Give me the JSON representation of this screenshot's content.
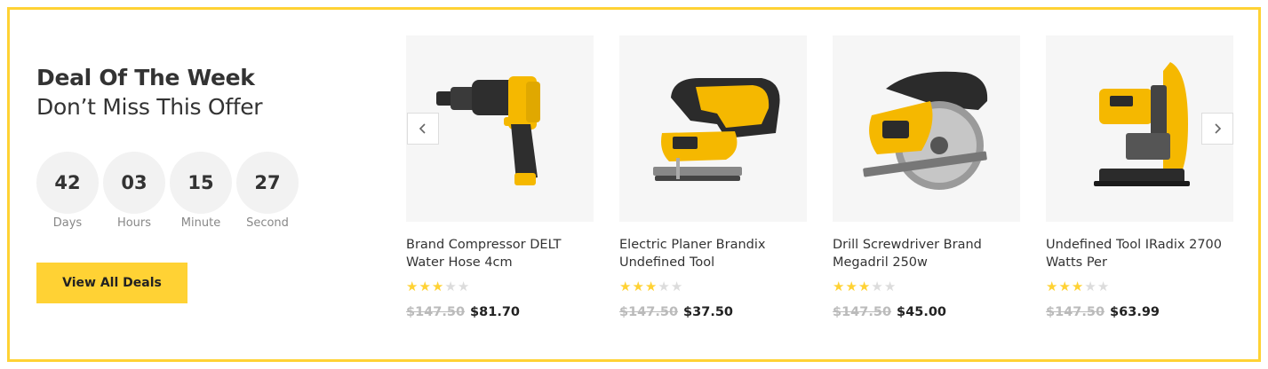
{
  "deal": {
    "title": "Deal Of The Week",
    "subtitle": "Don’t Miss This Offer",
    "view_all_label": "View All Deals",
    "accent_color": "#ffd234"
  },
  "countdown": [
    {
      "value": "42",
      "label": "Days"
    },
    {
      "value": "03",
      "label": "Hours"
    },
    {
      "value": "15",
      "label": "Minute"
    },
    {
      "value": "27",
      "label": "Second"
    }
  ],
  "carousel": {
    "prev_icon": "chevron-left-icon",
    "next_icon": "chevron-right-icon"
  },
  "products": [
    {
      "name": "Brand Compressor DELT Water Hose 4cm",
      "rating": 3,
      "rating_max": 5,
      "old_price": "$147.50",
      "price": "$81.70",
      "image": "impact-wrench-image"
    },
    {
      "name": "Electric Planer Brandix Undefined Tool",
      "rating": 3,
      "rating_max": 5,
      "old_price": "$147.50",
      "price": "$37.50",
      "image": "jigsaw-image"
    },
    {
      "name": "Drill Screwdriver Brand Megadril 250w",
      "rating": 3,
      "rating_max": 5,
      "old_price": "$147.50",
      "price": "$45.00",
      "image": "circular-saw-image"
    },
    {
      "name": "Undefined Tool IRadix 2700 Watts Per",
      "rating": 3,
      "rating_max": 5,
      "old_price": "$147.50",
      "price": "$63.99",
      "image": "chop-saw-image"
    }
  ]
}
